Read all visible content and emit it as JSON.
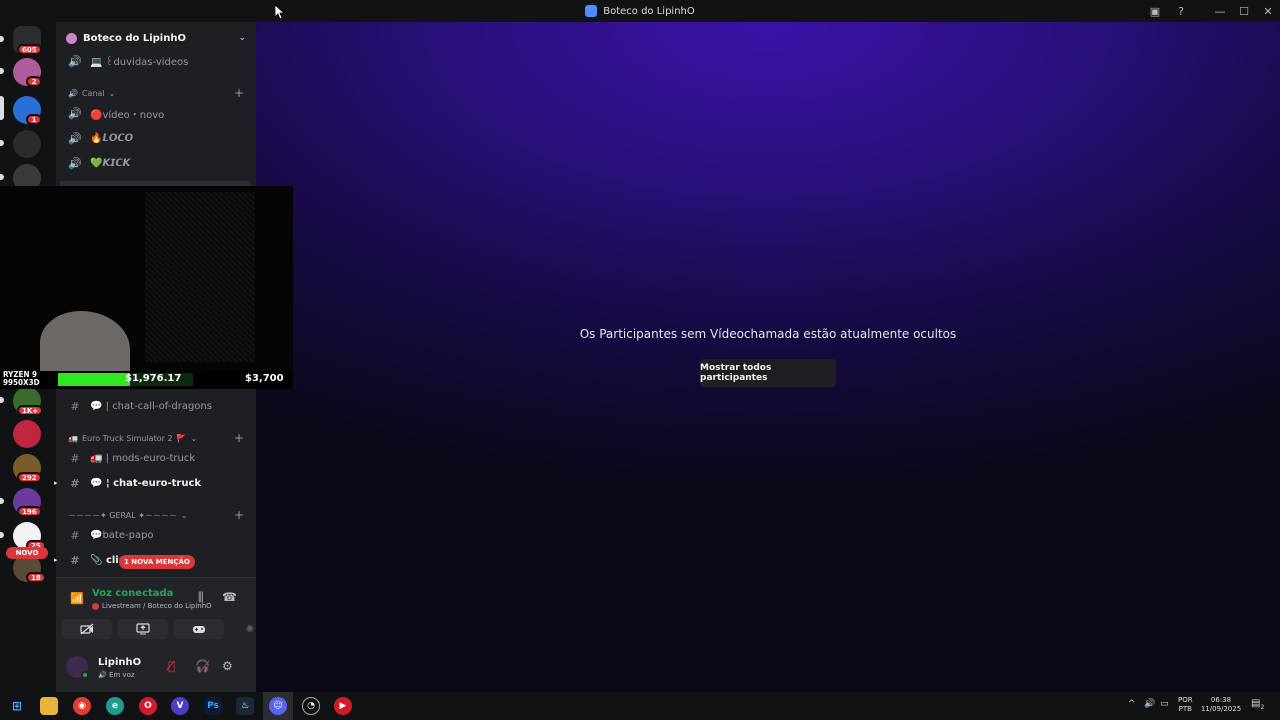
{
  "window": {
    "title": "Boteco do LipinhO"
  },
  "servers": [
    {
      "name": "discord-home",
      "badge": "605",
      "color": "#2b2d31"
    },
    {
      "name": "server-pink",
      "badge": "2",
      "color": "#b05b9c"
    },
    {
      "name": "server-v",
      "badge": "1",
      "color": "#2a6fd6"
    },
    {
      "name": "server-legacy",
      "badge": "",
      "color": "#2b2b2b"
    },
    {
      "name": "server-lg",
      "badge": "",
      "color": "#3a3a3a"
    },
    {
      "name": "server-green",
      "badge": "1K+",
      "color": "#3a6b2a"
    },
    {
      "name": "server-red",
      "badge": "",
      "color": "#c02640"
    },
    {
      "name": "server-games",
      "badge": "292",
      "color": "#7a5b2a"
    },
    {
      "name": "server-purple",
      "badge": "196",
      "color": "#6a3aa0"
    },
    {
      "name": "server-yinyang",
      "badge": "25",
      "color": "#f2f2f2"
    },
    {
      "name": "server-last",
      "badge": "18",
      "color": "#5a4a3a"
    }
  ],
  "novo_label": "NOVO",
  "sidebar": {
    "guild_name": "Boteco do LipinhO",
    "channels_top": [
      {
        "icon": "🔊",
        "emoji": "💻",
        "label": "꒰duvidas-videos"
      }
    ],
    "category_canal": "Canal",
    "canal_channels": [
      {
        "icon": "🔊",
        "emoji": "🔴",
        "label": "vídeo・novo"
      },
      {
        "icon": "🔊",
        "emoji": "🔥",
        "label": "𝙇𝙊𝘾𝙊"
      },
      {
        "icon": "🔊",
        "emoji": "💚",
        "label": "𝙆𝙄𝘾𝙆"
      }
    ],
    "channel_dragons": {
      "icon": "#",
      "emoji": "💬",
      "label": "| chat-call-of-dragons"
    },
    "category_euro": "Euro Truck Simulator 2",
    "euro_channels": [
      {
        "icon": "#",
        "emoji": "🚛",
        "label": "| mods-euro-truck",
        "unread": false
      },
      {
        "icon": "#",
        "emoji": "💬",
        "label": "¦ chat-euro-truck",
        "unread": true
      }
    ],
    "category_geral": "－－－－✦ GERAL ✦－－－－",
    "geral_channels": [
      {
        "icon": "#",
        "emoji": "💬",
        "label": "bate-papo",
        "unread": false
      },
      {
        "icon": "#",
        "emoji": "📎",
        "label": "clip",
        "unread": true
      }
    ],
    "mention_badge": "1 NOVA MENÇÃO"
  },
  "voice": {
    "status": "Voz conectada",
    "location": "Livestream / Boteco do LipinhO"
  },
  "user": {
    "name": "LipinhO",
    "status": "Em voz"
  },
  "stage": {
    "message": "Os Participantes sem Vídeochamada estão atualmente ocultos",
    "button": "Mostrar todos participantes"
  },
  "overlay": {
    "cpu_line1": "RYZEN 9",
    "cpu_line2": "9950X3D",
    "current": "$1,976.17",
    "goal": "$3,700",
    "progress_fraction": 0.534
  },
  "taskbar": {
    "lang1": "POR",
    "lang2": "PTB",
    "time": "06:38",
    "date": "11/09/2025",
    "notif_count": "2"
  },
  "colors": {
    "accent_green": "#23a55a",
    "badge_red": "#da373c",
    "progress_green": "#2fe81e",
    "stage_purple": "#3b12a8"
  }
}
